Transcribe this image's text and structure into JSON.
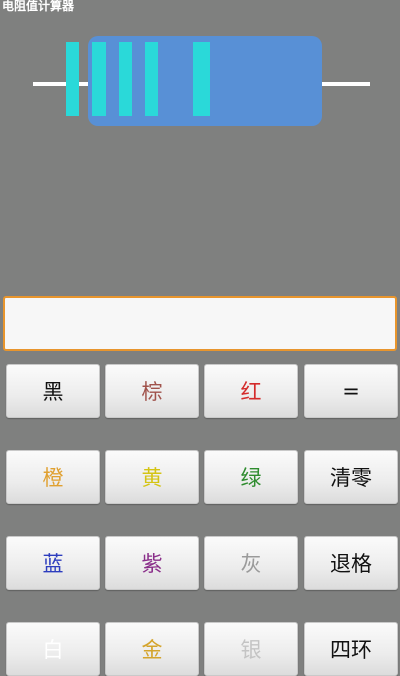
{
  "app": {
    "title": "电阻值计算器"
  },
  "display": {
    "value": ""
  },
  "keypad": [
    {
      "label": "黑",
      "color": "#111111"
    },
    {
      "label": "棕",
      "color": "#a0524b"
    },
    {
      "label": "红",
      "color": "#d42b2b"
    },
    {
      "label": "=",
      "color": "#111111"
    },
    {
      "label": "橙",
      "color": "#e0a030"
    },
    {
      "label": "黄",
      "color": "#d4c414"
    },
    {
      "label": "绿",
      "color": "#2e8c2e"
    },
    {
      "label": "清零",
      "color": "#111111"
    },
    {
      "label": "蓝",
      "color": "#2d3dbe"
    },
    {
      "label": "紫",
      "color": "#8a2f8a"
    },
    {
      "label": "灰",
      "color": "#9a9a9a"
    },
    {
      "label": "退格",
      "color": "#111111"
    },
    {
      "label": "白",
      "color": "#ffffff"
    },
    {
      "label": "金",
      "color": "#d4a42c"
    },
    {
      "label": "银",
      "color": "#c4c4c4"
    },
    {
      "label": "四环",
      "color": "#111111"
    }
  ],
  "resistor": {
    "body_color": "#5890d6",
    "band_color": "#2ad9d9",
    "lead_color": "#ffffff"
  }
}
